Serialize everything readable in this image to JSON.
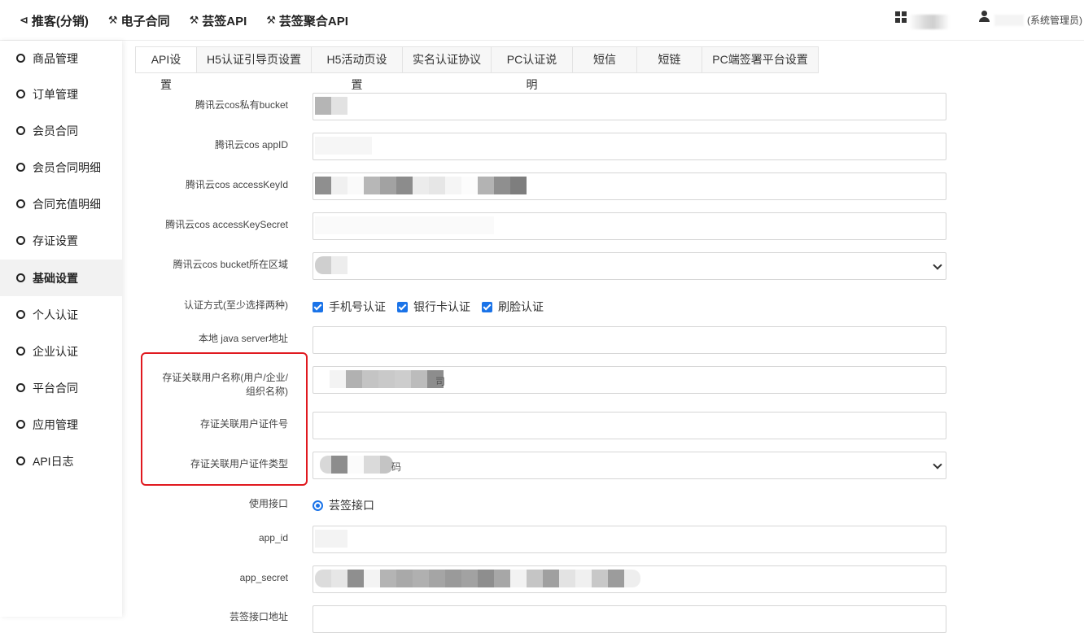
{
  "topnav": [
    {
      "icon": "share-icon",
      "glyph": "<",
      "label": "推客(分销)"
    },
    {
      "icon": "hammer-icon",
      "glyph": "⚒",
      "label": "电子合同"
    },
    {
      "icon": "hammer-icon",
      "glyph": "⚒",
      "label": "芸签API"
    },
    {
      "icon": "hammer-icon",
      "glyph": "⚒",
      "label": "芸签聚合API"
    }
  ],
  "header": {
    "role": "(系统管理员)"
  },
  "sidebar": {
    "items": [
      {
        "label": "商品管理"
      },
      {
        "label": "订单管理"
      },
      {
        "label": "会员合同"
      },
      {
        "label": "会员合同明细"
      },
      {
        "label": "合同充值明细"
      },
      {
        "label": "存证设置"
      },
      {
        "label": "基础设置",
        "active": true
      },
      {
        "label": "个人认证"
      },
      {
        "label": "企业认证"
      },
      {
        "label": "平台合同"
      },
      {
        "label": "应用管理"
      },
      {
        "label": "API日志"
      }
    ]
  },
  "tabs": [
    {
      "label": "API设置",
      "active": true
    },
    {
      "label": "H5认证引导页设置"
    },
    {
      "label": "H5活动页设置"
    },
    {
      "label": "实名认证协议"
    },
    {
      "label": "PC认证说明"
    },
    {
      "label": "短信"
    },
    {
      "label": "短链"
    },
    {
      "label": "PC端签署平台设置"
    }
  ],
  "form": {
    "cos_bucket_label": "腾讯云cos私有bucket",
    "cos_appid_label": "腾讯云cos appID",
    "cos_keyid_label": "腾讯云cos accessKeyId",
    "cos_keysecret_label": "腾讯云cos accessKeySecret",
    "cos_region_label": "腾讯云cos bucket所在区域",
    "auth_label": "认证方式(至少选择两种)",
    "auth_options": [
      "手机号认证",
      "银行卡认证",
      "刷脸认证"
    ],
    "java_label": "本地 java server地址",
    "holder_name_label": "存证关联用户名称(用户/企业/组织名称)",
    "holder_name_label_l1": "存证关联用户名称(用户/企业/",
    "holder_name_label_l2": "组织名称)",
    "holder_name_suffix": "司",
    "holder_id_label": "存证关联用户证件号",
    "holder_idtype_label": "存证关联用户证件类型",
    "holder_idtype_suffix": "码",
    "api_label": "使用接口",
    "api_option": "芸签接口",
    "appid_label": "app_id",
    "appsecret_label": "app_secret",
    "apiurl_label": "芸签接口地址"
  },
  "colors": {
    "accent": "#1a73e8",
    "highlight": "#e0191f"
  }
}
